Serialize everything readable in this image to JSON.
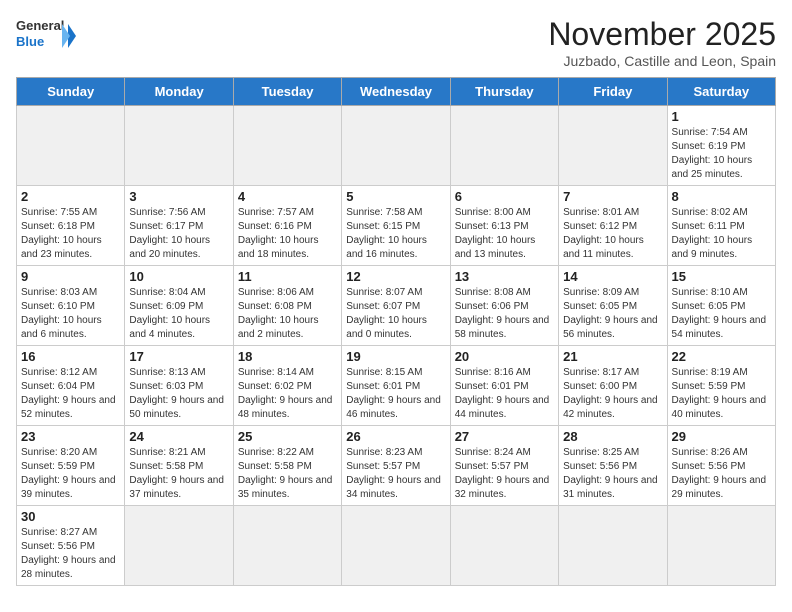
{
  "logo": {
    "text_general": "General",
    "text_blue": "Blue"
  },
  "title": "November 2025",
  "subtitle": "Juzbado, Castille and Leon, Spain",
  "weekdays": [
    "Sunday",
    "Monday",
    "Tuesday",
    "Wednesday",
    "Thursday",
    "Friday",
    "Saturday"
  ],
  "weeks": [
    [
      {
        "day": "",
        "info": ""
      },
      {
        "day": "",
        "info": ""
      },
      {
        "day": "",
        "info": ""
      },
      {
        "day": "",
        "info": ""
      },
      {
        "day": "",
        "info": ""
      },
      {
        "day": "",
        "info": ""
      },
      {
        "day": "1",
        "info": "Sunrise: 7:54 AM\nSunset: 6:19 PM\nDaylight: 10 hours and 25 minutes."
      }
    ],
    [
      {
        "day": "2",
        "info": "Sunrise: 7:55 AM\nSunset: 6:18 PM\nDaylight: 10 hours and 23 minutes."
      },
      {
        "day": "3",
        "info": "Sunrise: 7:56 AM\nSunset: 6:17 PM\nDaylight: 10 hours and 20 minutes."
      },
      {
        "day": "4",
        "info": "Sunrise: 7:57 AM\nSunset: 6:16 PM\nDaylight: 10 hours and 18 minutes."
      },
      {
        "day": "5",
        "info": "Sunrise: 7:58 AM\nSunset: 6:15 PM\nDaylight: 10 hours and 16 minutes."
      },
      {
        "day": "6",
        "info": "Sunrise: 8:00 AM\nSunset: 6:13 PM\nDaylight: 10 hours and 13 minutes."
      },
      {
        "day": "7",
        "info": "Sunrise: 8:01 AM\nSunset: 6:12 PM\nDaylight: 10 hours and 11 minutes."
      },
      {
        "day": "8",
        "info": "Sunrise: 8:02 AM\nSunset: 6:11 PM\nDaylight: 10 hours and 9 minutes."
      }
    ],
    [
      {
        "day": "9",
        "info": "Sunrise: 8:03 AM\nSunset: 6:10 PM\nDaylight: 10 hours and 6 minutes."
      },
      {
        "day": "10",
        "info": "Sunrise: 8:04 AM\nSunset: 6:09 PM\nDaylight: 10 hours and 4 minutes."
      },
      {
        "day": "11",
        "info": "Sunrise: 8:06 AM\nSunset: 6:08 PM\nDaylight: 10 hours and 2 minutes."
      },
      {
        "day": "12",
        "info": "Sunrise: 8:07 AM\nSunset: 6:07 PM\nDaylight: 10 hours and 0 minutes."
      },
      {
        "day": "13",
        "info": "Sunrise: 8:08 AM\nSunset: 6:06 PM\nDaylight: 9 hours and 58 minutes."
      },
      {
        "day": "14",
        "info": "Sunrise: 8:09 AM\nSunset: 6:05 PM\nDaylight: 9 hours and 56 minutes."
      },
      {
        "day": "15",
        "info": "Sunrise: 8:10 AM\nSunset: 6:05 PM\nDaylight: 9 hours and 54 minutes."
      }
    ],
    [
      {
        "day": "16",
        "info": "Sunrise: 8:12 AM\nSunset: 6:04 PM\nDaylight: 9 hours and 52 minutes."
      },
      {
        "day": "17",
        "info": "Sunrise: 8:13 AM\nSunset: 6:03 PM\nDaylight: 9 hours and 50 minutes."
      },
      {
        "day": "18",
        "info": "Sunrise: 8:14 AM\nSunset: 6:02 PM\nDaylight: 9 hours and 48 minutes."
      },
      {
        "day": "19",
        "info": "Sunrise: 8:15 AM\nSunset: 6:01 PM\nDaylight: 9 hours and 46 minutes."
      },
      {
        "day": "20",
        "info": "Sunrise: 8:16 AM\nSunset: 6:01 PM\nDaylight: 9 hours and 44 minutes."
      },
      {
        "day": "21",
        "info": "Sunrise: 8:17 AM\nSunset: 6:00 PM\nDaylight: 9 hours and 42 minutes."
      },
      {
        "day": "22",
        "info": "Sunrise: 8:19 AM\nSunset: 5:59 PM\nDaylight: 9 hours and 40 minutes."
      }
    ],
    [
      {
        "day": "23",
        "info": "Sunrise: 8:20 AM\nSunset: 5:59 PM\nDaylight: 9 hours and 39 minutes."
      },
      {
        "day": "24",
        "info": "Sunrise: 8:21 AM\nSunset: 5:58 PM\nDaylight: 9 hours and 37 minutes."
      },
      {
        "day": "25",
        "info": "Sunrise: 8:22 AM\nSunset: 5:58 PM\nDaylight: 9 hours and 35 minutes."
      },
      {
        "day": "26",
        "info": "Sunrise: 8:23 AM\nSunset: 5:57 PM\nDaylight: 9 hours and 34 minutes."
      },
      {
        "day": "27",
        "info": "Sunrise: 8:24 AM\nSunset: 5:57 PM\nDaylight: 9 hours and 32 minutes."
      },
      {
        "day": "28",
        "info": "Sunrise: 8:25 AM\nSunset: 5:56 PM\nDaylight: 9 hours and 31 minutes."
      },
      {
        "day": "29",
        "info": "Sunrise: 8:26 AM\nSunset: 5:56 PM\nDaylight: 9 hours and 29 minutes."
      }
    ],
    [
      {
        "day": "30",
        "info": "Sunrise: 8:27 AM\nSunset: 5:56 PM\nDaylight: 9 hours and 28 minutes."
      },
      {
        "day": "",
        "info": ""
      },
      {
        "day": "",
        "info": ""
      },
      {
        "day": "",
        "info": ""
      },
      {
        "day": "",
        "info": ""
      },
      {
        "day": "",
        "info": ""
      },
      {
        "day": "",
        "info": ""
      }
    ]
  ]
}
